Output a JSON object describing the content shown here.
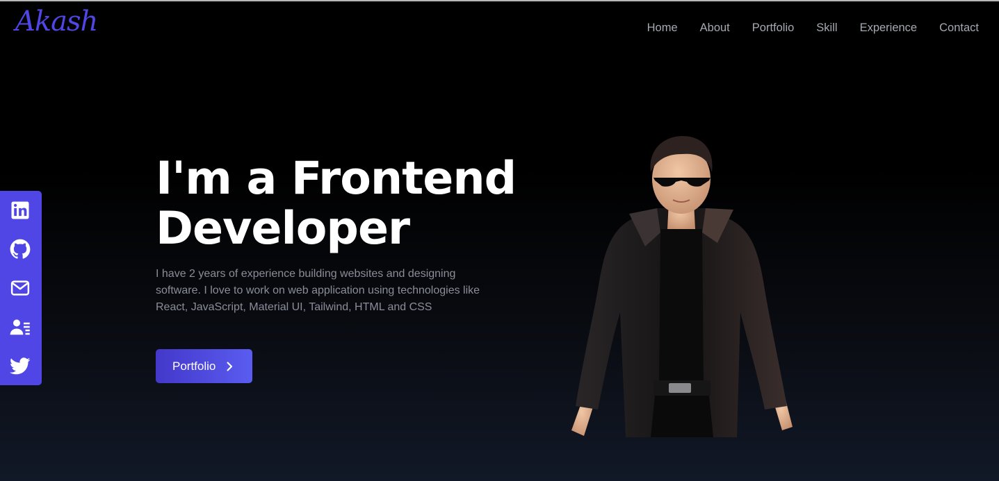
{
  "logo": {
    "text": "Akash",
    "color": "#4f46e5"
  },
  "nav": {
    "items": [
      {
        "label": "Home"
      },
      {
        "label": "About"
      },
      {
        "label": "Portfolio"
      },
      {
        "label": "Skill"
      },
      {
        "label": "Experience"
      },
      {
        "label": "Contact"
      }
    ]
  },
  "social": {
    "background": "#4f46e5",
    "icons": [
      "linkedin-icon",
      "github-icon",
      "mail-icon",
      "resume-icon",
      "twitter-icon"
    ]
  },
  "hero": {
    "title_line1": "I'm a Frontend",
    "title_line2": "Developer",
    "description": "I have 2 years of experience building websites and designing software. I love to work on web application using technologies like React, JavaScript, Material UI, Tailwind, HTML and CSS",
    "button_label": "Portfolio",
    "button_icon": "chevron-right-icon"
  },
  "colors": {
    "accent": "#4f46e5",
    "nav_text": "#a6a9b2",
    "desc_text": "#8a8e98"
  }
}
